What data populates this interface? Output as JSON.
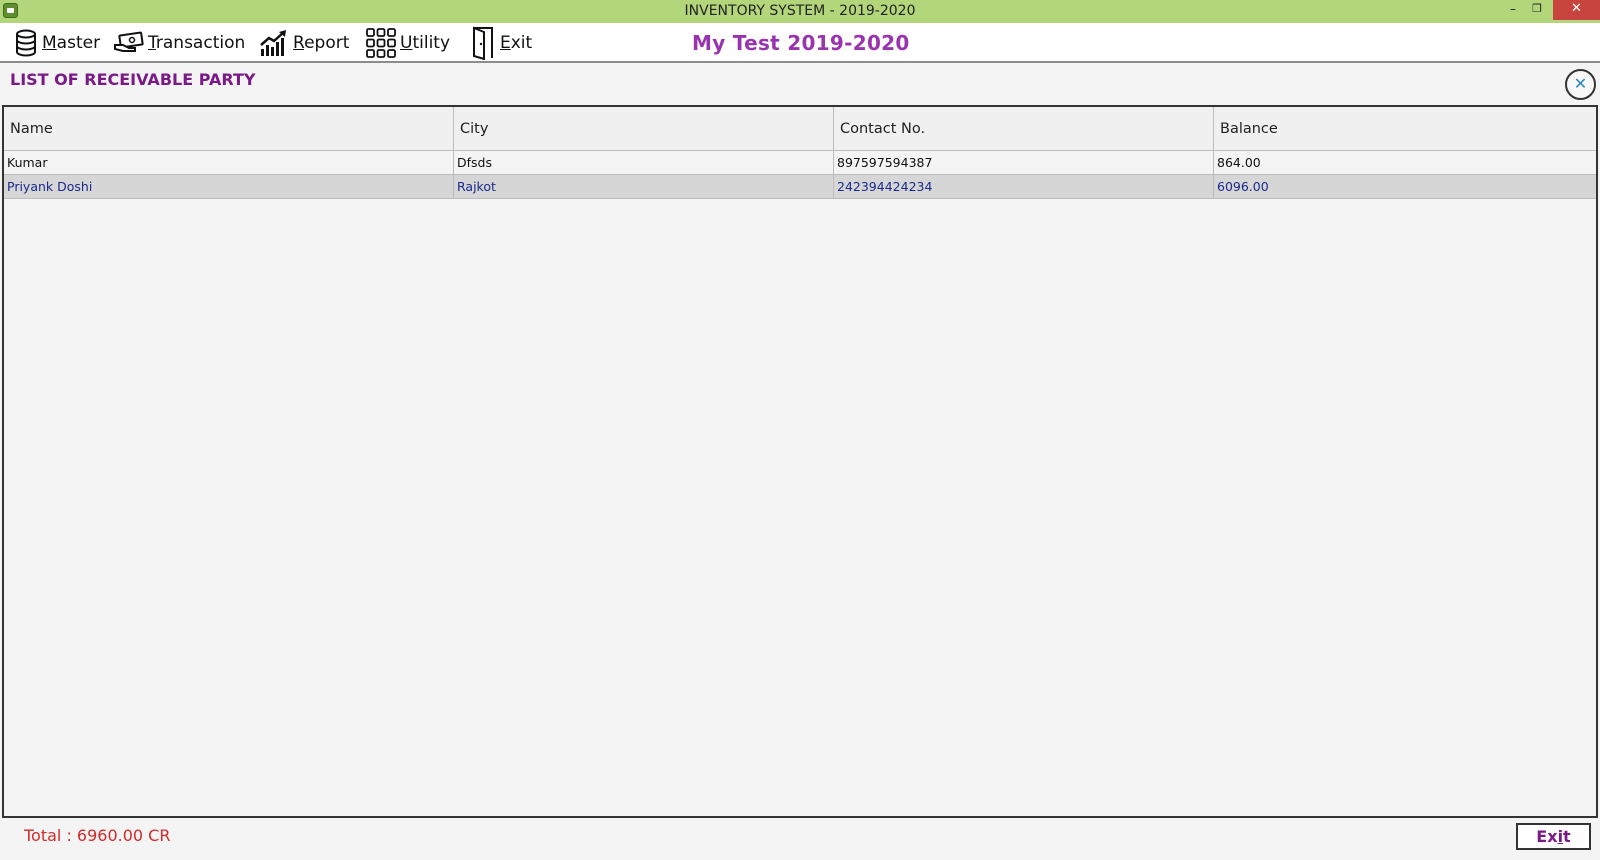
{
  "window": {
    "title": "INVENTORY SYSTEM - 2019-2020",
    "minimize_glyph": "–",
    "restore_glyph": "❐",
    "close_glyph": "✕"
  },
  "menu": {
    "master": {
      "first": "M",
      "rest": "aster",
      "icon": "database-icon"
    },
    "transaction": {
      "first": "T",
      "rest": "ransaction",
      "icon": "money-hand-icon"
    },
    "report": {
      "first": "R",
      "rest": "eport",
      "icon": "chart-trend-icon"
    },
    "utility": {
      "first": "U",
      "rest": "tility",
      "icon": "grid-icon"
    },
    "exit": {
      "first": "E",
      "rest": "xit",
      "icon": "door-exit-icon"
    }
  },
  "company_title": "My Test 2019-2020",
  "panel": {
    "title": "LIST OF RECEIVABLE PARTY",
    "close_glyph": "✕"
  },
  "grid": {
    "columns": [
      "Name",
      "City",
      "Contact No.",
      "Balance"
    ],
    "rows": [
      {
        "name": "Kumar",
        "city": "Dfsds",
        "contact": "897597594387",
        "balance": "864.00"
      },
      {
        "name": "Priyank Doshi",
        "city": "Rajkot",
        "contact": "242394424234",
        "balance": "6096.00"
      }
    ],
    "selected_row": 1
  },
  "footer": {
    "total": "Total : 6960.00 CR",
    "exit_first": "E",
    "exit_mid": "x",
    "exit_u": "i",
    "exit_rest": "t"
  },
  "colors": {
    "titlebar": "#b3d67a",
    "company_title": "#9a33b0",
    "panel_title": "#7a1a86",
    "total": "#d42a2a",
    "selected_row_bg": "#d6d6d6",
    "selected_row_text": "#1a2a8c"
  }
}
